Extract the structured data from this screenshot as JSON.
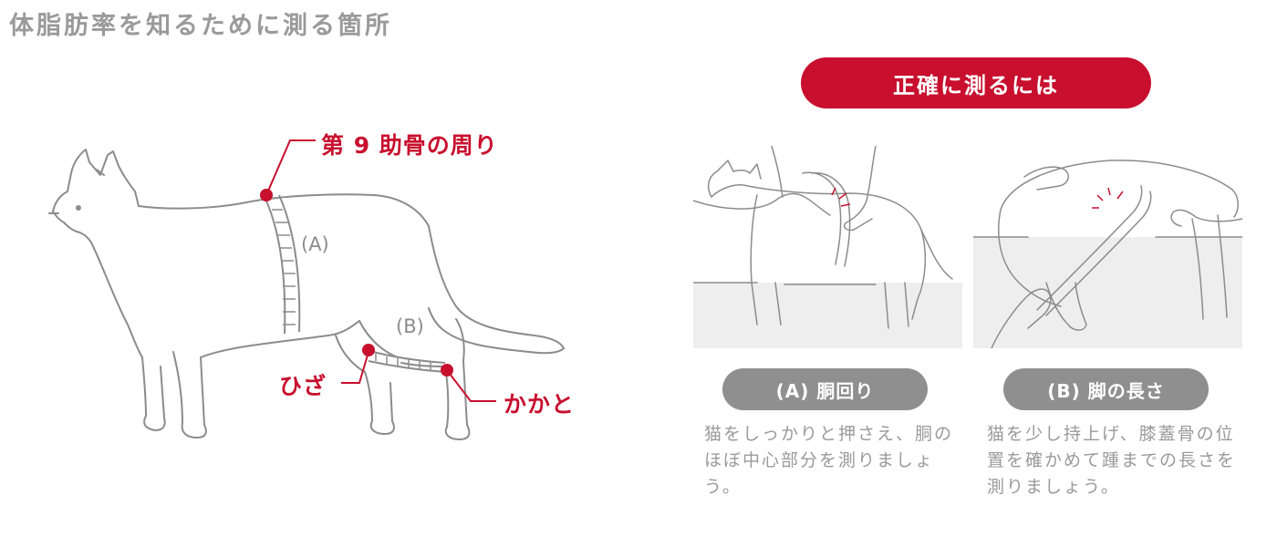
{
  "page": {
    "title": "体脂肪率を知るために測る箇所"
  },
  "cat_diagram": {
    "label_a": "(A)",
    "label_b": "(B)",
    "callouts": {
      "rib": "第 9 助骨の周り",
      "knee": "ひざ",
      "heel": "かかと"
    }
  },
  "how_to": {
    "header": "正確に測るには",
    "panels": [
      {
        "label": "(A) 胴回り",
        "description": "猫をしっかりと押さえ、胴のほぼ中心部分を測りましょう。"
      },
      {
        "label": "(B) 脚の長さ",
        "description": "猫を少し持上げ、膝蓋骨の位置を確かめて踵までの長さを測りましょう。"
      }
    ]
  },
  "colors": {
    "accent_red": "#c8102e",
    "pill_gray": "#8f8f8f",
    "text_gray": "#9a9a9a",
    "line_gray": "#8c8c8c",
    "floor_gray": "#eeeeee"
  }
}
